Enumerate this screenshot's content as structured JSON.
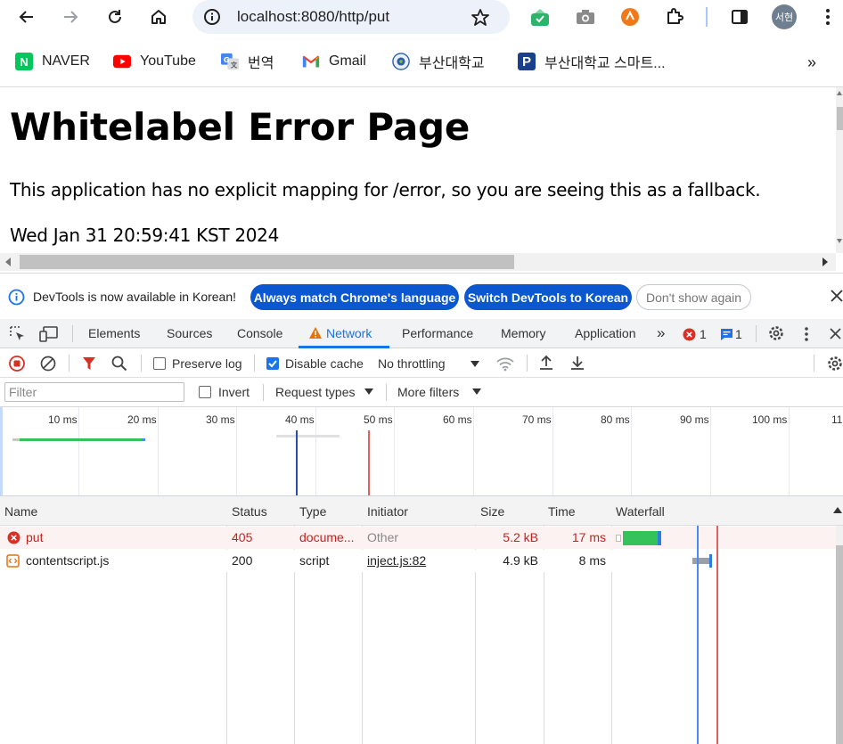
{
  "browser": {
    "url": "localhost:8080/http/put",
    "profile_initial": "서현"
  },
  "bookmarks": [
    {
      "label": "NAVER",
      "icon": "naver-icon"
    },
    {
      "label": "YouTube",
      "icon": "youtube-icon"
    },
    {
      "label": "번역",
      "icon": "translate-icon"
    },
    {
      "label": "Gmail",
      "icon": "gmail-icon"
    },
    {
      "label": "부산대학교",
      "icon": "pnu-seal-icon"
    },
    {
      "label": "부산대학교 스마트...",
      "icon": "pnu-p-icon"
    }
  ],
  "page": {
    "title": "Whitelabel Error Page",
    "message": "This application has no explicit mapping for /error, so you are seeing this as a fallback.",
    "timestamp": "Wed Jan 31 20:59:41 KST 2024"
  },
  "banner": {
    "text": "DevTools is now available in Korean!",
    "btn_match": "Always match Chrome's language",
    "btn_switch": "Switch DevTools to Korean",
    "btn_dismiss": "Don't show again"
  },
  "devtools": {
    "tabs": [
      "Elements",
      "Sources",
      "Console",
      "Network",
      "Performance",
      "Memory",
      "Application"
    ],
    "active_tab": "Network",
    "error_count": "1",
    "message_count": "1"
  },
  "network_toolbar": {
    "preserve_log": "Preserve log",
    "preserve_log_checked": false,
    "disable_cache": "Disable cache",
    "disable_cache_checked": true,
    "throttling": "No throttling"
  },
  "filter_row": {
    "filter_placeholder": "Filter",
    "invert": "Invert",
    "request_types": "Request types",
    "more_filters": "More filters"
  },
  "overview": {
    "ticks": [
      "10 ms",
      "20 ms",
      "30 ms",
      "40 ms",
      "50 ms",
      "60 ms",
      "70 ms",
      "80 ms",
      "90 ms",
      "100 ms",
      "11"
    ]
  },
  "table": {
    "columns": [
      "Name",
      "Status",
      "Type",
      "Initiator",
      "Size",
      "Time",
      "Waterfall"
    ],
    "rows": [
      {
        "name": "put",
        "status": "405",
        "type": "docume...",
        "initiator": "Other",
        "size": "5.2 kB",
        "time": "17 ms",
        "error": true
      },
      {
        "name": "contentscript.js",
        "status": "200",
        "type": "script",
        "initiator": "inject.js:82",
        "size": "4.9 kB",
        "time": "8 ms",
        "error": false
      }
    ]
  },
  "colors": {
    "accent": "#1a73e8",
    "button_blue": "#0b57d0",
    "error": "#c5221f",
    "waterfall_green": "#34c25a"
  }
}
